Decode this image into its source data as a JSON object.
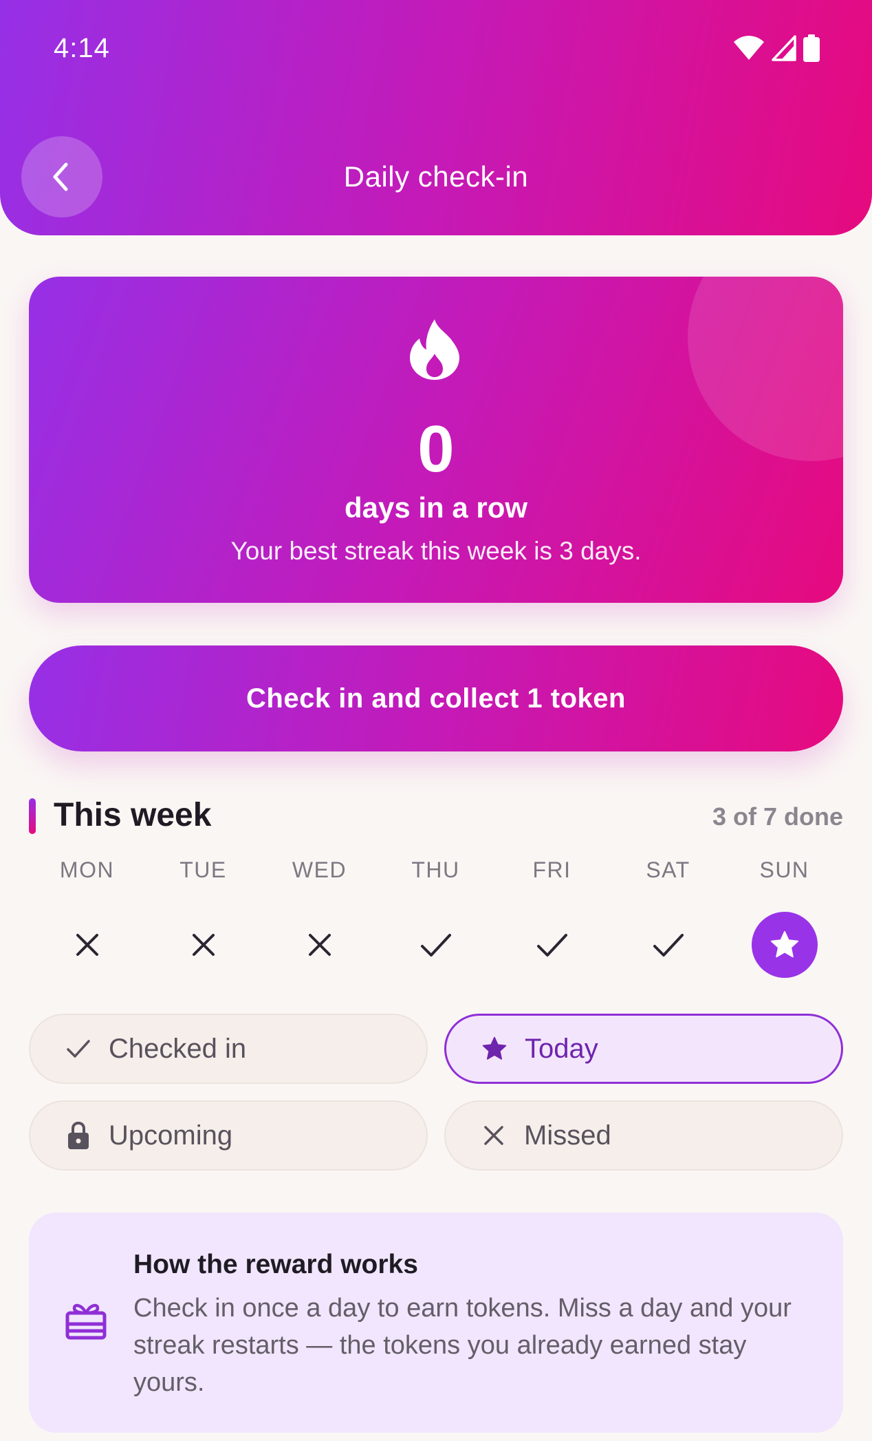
{
  "status_bar": {
    "time": "4:14"
  },
  "header": {
    "title": "Daily check-in"
  },
  "streak": {
    "count": "0",
    "label": "days in a row",
    "subtitle": "Your best streak this week is 3 days."
  },
  "checkin_button": {
    "label": "Check in and collect 1 token"
  },
  "week": {
    "title": "This week",
    "progress": "3 of 7 done",
    "days": [
      {
        "label": "MON",
        "status": "missed"
      },
      {
        "label": "TUE",
        "status": "missed"
      },
      {
        "label": "WED",
        "status": "missed"
      },
      {
        "label": "THU",
        "status": "checked"
      },
      {
        "label": "FRI",
        "status": "checked"
      },
      {
        "label": "SAT",
        "status": "checked"
      },
      {
        "label": "SUN",
        "status": "today"
      }
    ]
  },
  "legend": {
    "checked_in": "Checked in",
    "today": "Today",
    "upcoming": "Upcoming",
    "missed": "Missed"
  },
  "info": {
    "title": "How the reward works",
    "body": "Check in once a day to earn tokens. Miss a day and your streak restarts — the tokens you already earned stay yours."
  },
  "colors": {
    "gradient_start": "#9630e6",
    "gradient_end": "#e60a7e",
    "accent": "#9933e8",
    "background": "#faf6f4",
    "info_background": "#f1e6fd"
  }
}
